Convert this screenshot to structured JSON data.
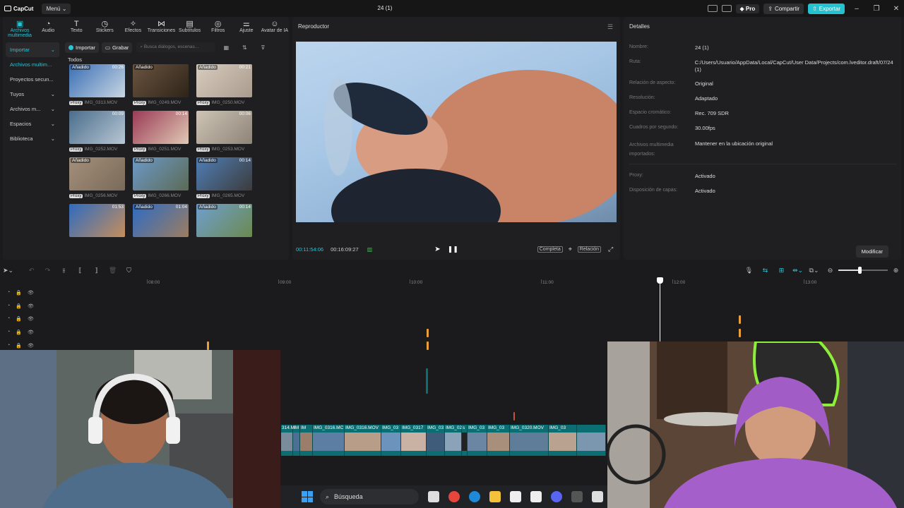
{
  "app": {
    "logo": "CapCut",
    "menu": "Menú",
    "project_title": "24 (1)",
    "pro": "Pro",
    "share": "Compartir",
    "export": "Exportar"
  },
  "tool_tabs": [
    {
      "label": "Archivos multimedia",
      "icon": "media-icon"
    },
    {
      "label": "Audio",
      "icon": "audio-icon"
    },
    {
      "label": "Texto",
      "icon": "text-icon"
    },
    {
      "label": "Stickers",
      "icon": "sticker-icon"
    },
    {
      "label": "Efectos",
      "icon": "effects-icon"
    },
    {
      "label": "Transiciones",
      "icon": "transitions-icon"
    },
    {
      "label": "Subtítulos",
      "icon": "subtitles-icon"
    },
    {
      "label": "Filtros",
      "icon": "filters-icon"
    },
    {
      "label": "Ajuste",
      "icon": "adjust-icon"
    },
    {
      "label": "Avatar de IA",
      "icon": "avatar-icon"
    }
  ],
  "sidebar": [
    {
      "label": "Importar",
      "chev": "⌄"
    },
    {
      "label": "Archivos multim...",
      "chev": ""
    },
    {
      "label": "Proyectos secun...",
      "chev": ""
    },
    {
      "label": "Tuyos",
      "chev": "⌄"
    },
    {
      "label": "Archivos m...",
      "chev": "⌄"
    },
    {
      "label": "Espacios",
      "chev": "⌄"
    },
    {
      "label": "Biblioteca",
      "chev": "⌄"
    }
  ],
  "media": {
    "import_btn": "Importar",
    "record_btn": "Grabar",
    "search_placeholder": "Busca diálogos, escenas...",
    "section": "Todos",
    "items": [
      {
        "name": "IMG_0313.MOV",
        "badge": "Añadido",
        "dur": "00:26",
        "proxy": "Proxy",
        "colors": [
          "#3a6fb5",
          "#c9d6e3"
        ]
      },
      {
        "name": "IMG_0249.MOV",
        "badge": "Añadido",
        "dur": "",
        "proxy": "Proxy",
        "colors": [
          "#6b5440",
          "#2e2418"
        ]
      },
      {
        "name": "IMG_0250.MOV",
        "badge": "Añadido",
        "dur": "00:21",
        "proxy": "Proxy",
        "colors": [
          "#d8ccbf",
          "#a99c8e"
        ]
      },
      {
        "name": "IMG_0252.MOV",
        "badge": "",
        "dur": "00:09",
        "proxy": "Proxy",
        "colors": [
          "#4a6d8c",
          "#b8c7d4"
        ]
      },
      {
        "name": "IMG_0251.MOV",
        "badge": "",
        "dur": "00:14",
        "proxy": "Proxy",
        "colors": [
          "#9b3a55",
          "#e0c9b4"
        ]
      },
      {
        "name": "IMG_0253.MOV",
        "badge": "",
        "dur": "00:06",
        "proxy": "Proxy",
        "colors": [
          "#cfc4b5",
          "#8d8478"
        ]
      },
      {
        "name": "IMG_0256.MOV",
        "badge": "Añadido",
        "dur": "",
        "proxy": "Proxy",
        "colors": [
          "#a4907b",
          "#7a6a59"
        ]
      },
      {
        "name": "IMG_0266.MOV",
        "badge": "Añadido",
        "dur": "",
        "proxy": "Proxy",
        "colors": [
          "#6d9ac9",
          "#5b6a55"
        ]
      },
      {
        "name": "IMG_0265.MOV",
        "badge": "Añadido",
        "dur": "00:14",
        "proxy": "Proxy",
        "colors": [
          "#4f7fb6",
          "#3c3b3d"
        ]
      },
      {
        "name": "",
        "badge": "",
        "dur": "01:53",
        "proxy": "",
        "colors": [
          "#2f6bc0",
          "#c58e5b"
        ]
      },
      {
        "name": "",
        "badge": "Añadido",
        "dur": "01:04",
        "proxy": "",
        "colors": [
          "#2d6bc4",
          "#9c7d60"
        ]
      },
      {
        "name": "",
        "badge": "Añadido",
        "dur": "00:14",
        "proxy": "",
        "colors": [
          "#6f9fd0",
          "#6b8a4f"
        ]
      }
    ]
  },
  "player": {
    "title": "Reproductor",
    "current": "00:11:54:06",
    "total": "00:16:09:27",
    "full_btn": "Completa",
    "ratio_btn": "Relación"
  },
  "details": {
    "title": "Detalles",
    "rows": [
      {
        "label": "Nombre:",
        "value": "24 (1)"
      },
      {
        "label": "Ruta:",
        "value": "C:/Users/Usuario/AppData/Local/CapCut/User Data/Projects/com.lveditor.draft/07/24 (1)"
      },
      {
        "label": "Relación de aspecto:",
        "value": "Original"
      },
      {
        "label": "Resolución:",
        "value": "Adaptado"
      },
      {
        "label": "Espacio cromático:",
        "value": "Rec. 709 SDR"
      },
      {
        "label": "Cuadros por segundo:",
        "value": "30.00fps"
      },
      {
        "label": "Archivos multimedia importados:",
        "value": "Mantener en la ubicación original"
      },
      {
        "label": "Proxy:",
        "value": "Activado"
      },
      {
        "label": "Disposición de capas:",
        "value": "Activado"
      }
    ],
    "modify": "Modificar"
  },
  "timeline": {
    "ruler": [
      "08:00",
      "09:00",
      "10:00",
      "11:00",
      "12:00",
      "13:00"
    ],
    "clips": [
      "314.M",
      "IM",
      "IM",
      "IMG_0316.MC",
      "IMG_0316.MOV",
      "IMG_03",
      "IMG_0317",
      "IMG_03",
      "IMG_02",
      "s",
      "IMG_03",
      "IMG_03",
      "IMG_0320.MOV",
      "IMG_03"
    ]
  },
  "taskbar": {
    "search": "Búsqueda"
  }
}
